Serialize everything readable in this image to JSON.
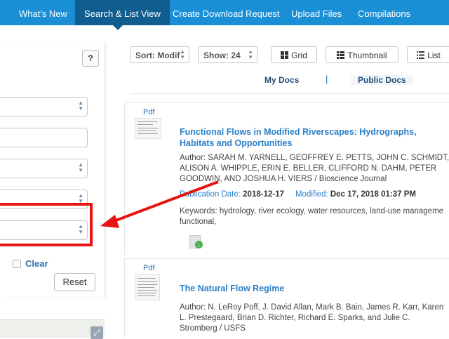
{
  "nav": {
    "tabs": [
      {
        "label": "What's New"
      },
      {
        "label": "Search & List View"
      },
      {
        "label": "Create Download Request"
      },
      {
        "label": "Upload Files"
      },
      {
        "label": "Compilations"
      }
    ]
  },
  "sidebar": {
    "help_label": "?",
    "clear_label": "Clear",
    "reset_label": "Reset"
  },
  "toolbar": {
    "sort_label": "Sort: Modif",
    "show_label": "Show: 24",
    "view_grid": "Grid",
    "view_thumbnail": "Thumbnail",
    "view_list": "List"
  },
  "docs_tabs": {
    "my_docs": "My Docs",
    "separator": "|",
    "public_docs": "Public Docs"
  },
  "results": [
    {
      "type": "Pdf",
      "title_line1": "Functional Flows in Modified Riverscapes: Hydrographs,",
      "title_line2": "Habitats and Opportunities",
      "author_line1": "Author: SARAH M. YARNELL, GEOFFREY E. PETTS, JOHN C. SCHMIDT,",
      "author_line2": "ALISON A. WHIPPLE, ERIN E. BELLER, CLIFFORD N. DAHM, PETER",
      "author_line3": "GOODWIN, AND JOSHUA H. VIERS / Bioscience Journal",
      "pub_label": "Publication Date:",
      "pub_value": "2018-12-17",
      "mod_label": "Modified:",
      "mod_value": "Dec 17, 2018 01:37 PM",
      "keywords_line1": "Keywords: hydrology, river ecology, water resources, land-use manageme",
      "keywords_line2": "functional,"
    },
    {
      "type": "Pdf",
      "title_line1": "The Natural Flow Regime",
      "author_line1": "Author: N. LeRoy Poff, J. David Allan, Mark B. Bain, James R. Karr, Karen",
      "author_line2": "L. Prestegaard, Brian D. Richter, Richard E. Sparks, and Julie C.",
      "author_line3": "Stromberg / USFS"
    }
  ],
  "colors": {
    "nav_bg": "#1a8fd6",
    "nav_active": "#0f5e8f",
    "link": "#2a7fc9",
    "annotation_red": "#e81313"
  }
}
